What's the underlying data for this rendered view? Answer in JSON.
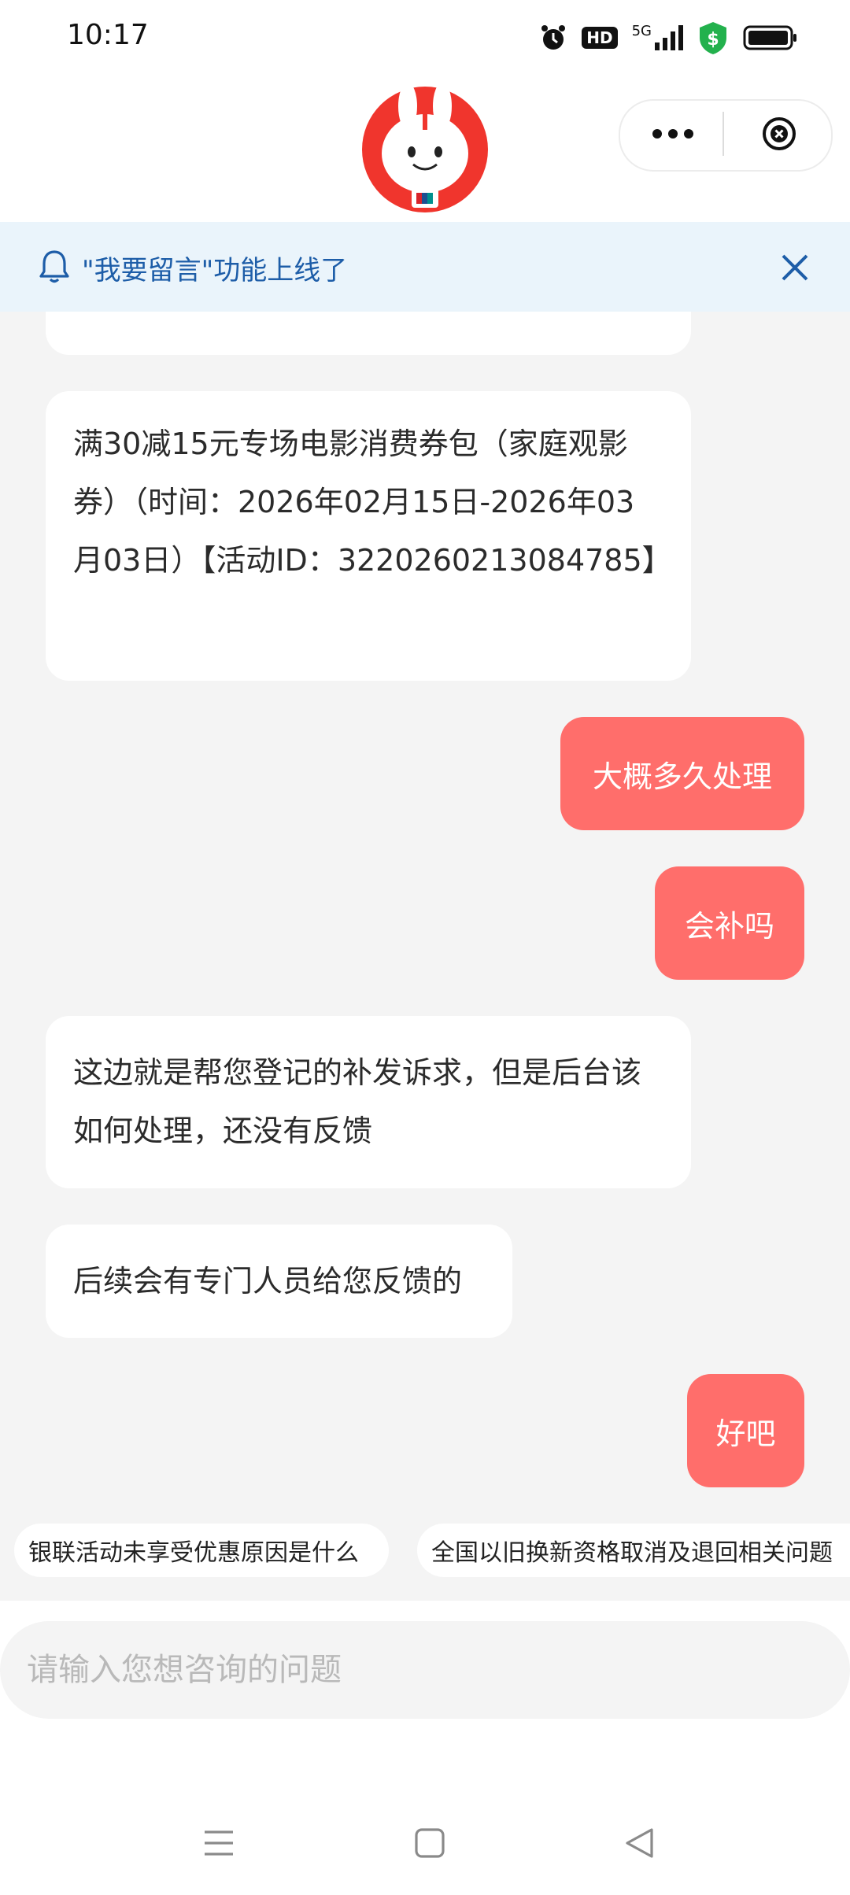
{
  "status_bar": {
    "time": "10:17",
    "hd_label": "HD",
    "network": "5G"
  },
  "header": {
    "more_label": "•••"
  },
  "notice": {
    "text": "\"我要留言\"功能上线了"
  },
  "messages": [
    {
      "role": "service",
      "text": "满30减15元专场电影消费券包（家庭观影券）（时间：2026年02月15日-2026年03月03日）【活动ID：3220260213084785】"
    },
    {
      "role": "user",
      "text": "大概多久处理"
    },
    {
      "role": "user",
      "text": "会补吗"
    },
    {
      "role": "service",
      "text": "这边就是帮您登记的补发诉求，但是后台该如何处理，还没有反馈"
    },
    {
      "role": "service",
      "text": "后续会有专门人员给您反馈的"
    },
    {
      "role": "user",
      "text": "好吧"
    }
  ],
  "suggestions": [
    "银联活动未享受优惠原因是什么",
    "全国以旧换新资格取消及退回相关问题"
  ],
  "input": {
    "placeholder": "请输入您想咨询的问题"
  },
  "colors": {
    "user_bubble": "#ff6e6b",
    "notice_text": "#1d5da8",
    "notice_bg": "#eaf4fb",
    "page_bg": "#f4f4f4"
  }
}
